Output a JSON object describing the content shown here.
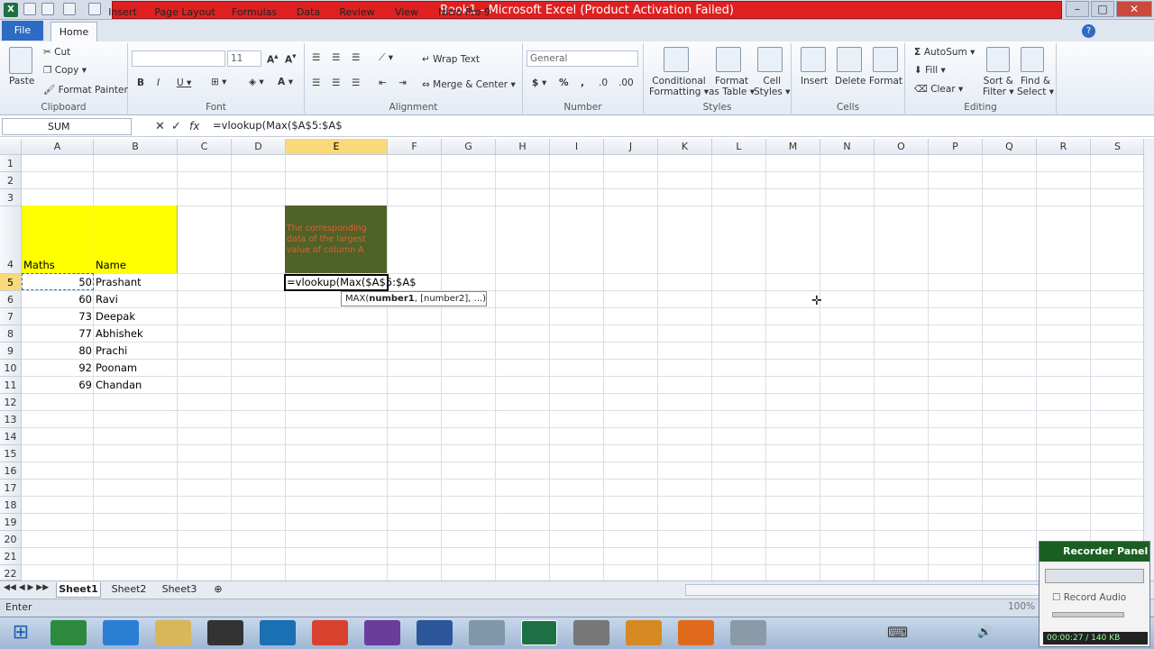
{
  "window": {
    "title": "Book1 - Microsoft Excel (Product Activation Failed)",
    "minimize": "–",
    "maximize": "□",
    "close": "✕"
  },
  "tabs": [
    "File",
    "Home",
    "Insert",
    "Page Layout",
    "Formulas",
    "Data",
    "Review",
    "View",
    "Nitro Pro 9"
  ],
  "ribbon": {
    "clipboard": {
      "paste": "Paste",
      "cut": "Cut",
      "copy": "Copy",
      "format_painter": "Format Painter",
      "label": "Clipboard"
    },
    "font": {
      "size": "11",
      "label": "Font"
    },
    "alignment": {
      "wrap_text": "Wrap Text",
      "merge_center": "Merge & Center",
      "label": "Alignment"
    },
    "number": {
      "format": "General",
      "label": "Number"
    },
    "styles": {
      "conditional": "Conditional",
      "formatting": "Formatting",
      "format_as": "Format",
      "as_table": "as Table",
      "cell": "Cell",
      "styles": "Styles",
      "label": "Styles"
    },
    "cells": {
      "insert": "Insert",
      "delete": "Delete",
      "format": "Format",
      "label": "Cells"
    },
    "editing": {
      "autosum": "AutoSum",
      "fill": "Fill",
      "clear": "Clear",
      "sort": "Sort &",
      "filter": "Filter",
      "find": "Find &",
      "select": "Select",
      "label": "Editing"
    }
  },
  "formula_bar": {
    "name_box": "SUM",
    "content": "=vlookup(Max($A$5:$A$"
  },
  "columns": [
    "A",
    "B",
    "C",
    "D",
    "E",
    "F",
    "G",
    "H",
    "I",
    "J",
    "K",
    "L",
    "M",
    "N",
    "O",
    "P",
    "Q",
    "R",
    "S"
  ],
  "rows": [
    "1",
    "2",
    "3",
    "4",
    "5",
    "6",
    "7",
    "8",
    "9",
    "10",
    "11",
    "12",
    "13",
    "14",
    "15",
    "16",
    "17",
    "18",
    "19",
    "20",
    "21",
    "22"
  ],
  "cells": {
    "A4": "Maths",
    "B4": "Name",
    "E4": "The corresponding data of the largest value of column A",
    "E5": "=vlookup(Max($A$5:$A$",
    "data": [
      {
        "a": "50",
        "b": "Prashant"
      },
      {
        "a": "60",
        "b": "Ravi"
      },
      {
        "a": "73",
        "b": "Deepak"
      },
      {
        "a": "77",
        "b": "Abhishek"
      },
      {
        "a": "80",
        "b": "Prachi"
      },
      {
        "a": "92",
        "b": "Poonam"
      },
      {
        "a": "69",
        "b": "Chandan"
      }
    ]
  },
  "tooltip": {
    "fn": "MAX(",
    "bold": "number1",
    "rest": ", [number2], ...)"
  },
  "sheets": [
    "Sheet1",
    "Sheet2",
    "Sheet3"
  ],
  "status": {
    "mode": "Enter",
    "zoom": "100%"
  },
  "recorder": {
    "title": "Recorder Panel",
    "record_audio": "Record Audio",
    "time": "00:00:27 / 140 KB"
  },
  "colors": {
    "yellow": "#ffff00",
    "green_cell": "#4f6228",
    "selected_header": "#f9d97a",
    "title_red": "#e02020"
  }
}
